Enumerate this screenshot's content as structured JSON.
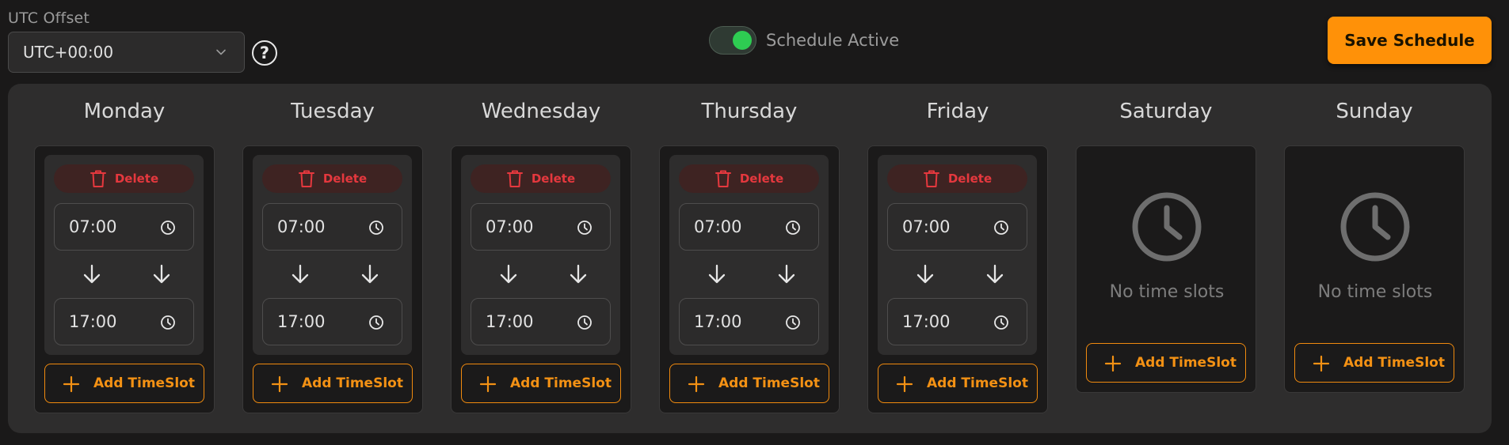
{
  "header": {
    "utc_label": "UTC Offset",
    "utc_value": "UTC+00:00",
    "help_glyph": "?",
    "schedule_active_label": "Schedule Active",
    "schedule_active": true,
    "save_label": "Save Schedule"
  },
  "colors": {
    "accent": "#ff9108",
    "toggle_on": "#2ecc52",
    "delete": "#e5383e"
  },
  "days": [
    {
      "name": "Monday",
      "has_slot": true,
      "delete_label": "Delete",
      "start": "07:00",
      "end": "17:00",
      "add_line1": "Add Time",
      "add_line2": "Slot"
    },
    {
      "name": "Tuesday",
      "has_slot": true,
      "delete_label": "Delete",
      "start": "07:00",
      "end": "17:00",
      "add_line1": "Add Time",
      "add_line2": "Slot"
    },
    {
      "name": "Wednesday",
      "has_slot": true,
      "delete_label": "Delete",
      "start": "07:00",
      "end": "17:00",
      "add_line1": "Add Time",
      "add_line2": "Slot"
    },
    {
      "name": "Thursday",
      "has_slot": true,
      "delete_label": "Delete",
      "start": "07:00",
      "end": "17:00",
      "add_line1": "Add Time",
      "add_line2": "Slot"
    },
    {
      "name": "Friday",
      "has_slot": true,
      "delete_label": "Delete",
      "start": "07:00",
      "end": "17:00",
      "add_line1": "Add Time",
      "add_line2": "Slot"
    },
    {
      "name": "Saturday",
      "has_slot": false,
      "empty_label": "No time slots",
      "add_line1": "Add Time",
      "add_line2": "Slot"
    },
    {
      "name": "Sunday",
      "has_slot": false,
      "empty_label": "No time slots",
      "add_line1": "Add Time",
      "add_line2": "Slot"
    }
  ]
}
